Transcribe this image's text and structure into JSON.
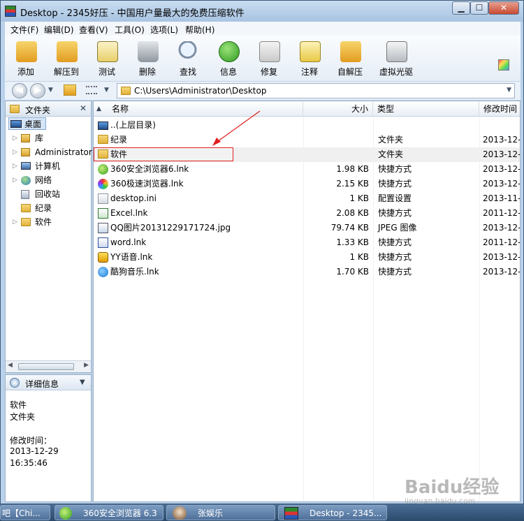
{
  "window": {
    "title": "Desktop - 2345好压 - 中国用户量最大的免费压缩软件"
  },
  "menu": [
    "文件(F)",
    "编辑(D)",
    "查看(V)",
    "工具(O)",
    "选项(L)",
    "帮助(H)"
  ],
  "toolbar": [
    {
      "label": "添加",
      "icon": "add-icon"
    },
    {
      "label": "解压到",
      "icon": "extract-icon"
    },
    {
      "label": "测试",
      "icon": "test-icon"
    },
    {
      "label": "删除",
      "icon": "delete-icon"
    },
    {
      "label": "查找",
      "icon": "search-icon"
    },
    {
      "label": "信息",
      "icon": "info-icon"
    },
    {
      "label": "修复",
      "icon": "repair-icon"
    },
    {
      "label": "注释",
      "icon": "comment-icon"
    },
    {
      "label": "自解压",
      "icon": "sfx-icon"
    },
    {
      "label": "虚拟光驱",
      "icon": "virtual-drive-icon"
    }
  ],
  "address": {
    "path": "C:\\Users\\Administrator\\Desktop"
  },
  "tree": {
    "header": "文件夹",
    "items": [
      "桌面",
      "库",
      "Administrator",
      "计算机",
      "网络",
      "回收站",
      "纪录",
      "软件"
    ]
  },
  "details": {
    "header": "详细信息",
    "name": "软件",
    "type": "文件夹",
    "modified_label": "修改时间：",
    "modified_date": "2013-12-29",
    "modified_time": "16:35:46"
  },
  "columns": {
    "name": "名称",
    "size": "大小",
    "type": "类型",
    "modified": "修改时间"
  },
  "files": [
    {
      "name": "..(上层目录)",
      "size": "",
      "type": "",
      "modified": ""
    },
    {
      "name": "纪录",
      "size": "",
      "type": "文件夹",
      "modified": "2013-12-"
    },
    {
      "name": "软件",
      "size": "",
      "type": "文件夹",
      "modified": "2013-12-"
    },
    {
      "name": "360安全浏览器6.lnk",
      "size": "1.98 KB",
      "type": "快捷方式",
      "modified": "2013-12-"
    },
    {
      "name": "360极速浏览器.lnk",
      "size": "2.15 KB",
      "type": "快捷方式",
      "modified": "2013-12-"
    },
    {
      "name": "desktop.ini",
      "size": "1 KB",
      "type": "配置设置",
      "modified": "2013-11-"
    },
    {
      "name": "Excel.lnk",
      "size": "2.08 KB",
      "type": "快捷方式",
      "modified": "2011-12-"
    },
    {
      "name": "QQ图片20131229171724.jpg",
      "size": "79.74 KB",
      "type": "JPEG 图像",
      "modified": "2013-12-"
    },
    {
      "name": "word.lnk",
      "size": "1.33 KB",
      "type": "快捷方式",
      "modified": "2011-12-"
    },
    {
      "name": "YY语音.lnk",
      "size": "1 KB",
      "type": "快捷方式",
      "modified": "2013-12-"
    },
    {
      "name": "酷狗音乐.lnk",
      "size": "1.70 KB",
      "type": "快捷方式",
      "modified": "2013-12-"
    }
  ],
  "taskbar": [
    "吧【Chi...",
    "360安全浏览器 6.3",
    "张娱乐",
    "Desktop - 2345..."
  ],
  "watermark": {
    "brand": "Baidu经验",
    "url": "jingyan.baidu.com"
  },
  "colors": {
    "selection_outline": "#e02020",
    "arrow": "#e02020",
    "title_bg": "#b9d1ea"
  }
}
